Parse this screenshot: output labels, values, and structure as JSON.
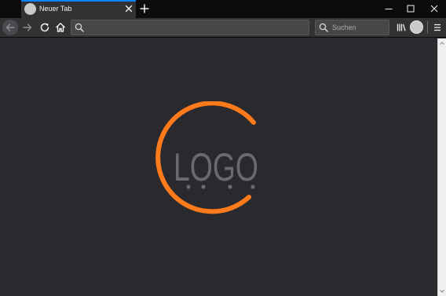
{
  "tab": {
    "title": "Neuer Tab"
  },
  "searchbar": {
    "placeholder": "Suchen"
  },
  "page": {
    "logo_text": "LOGO"
  },
  "colors": {
    "tab_accent": "#0a84ff",
    "logo_ring": "#ff7a1a",
    "logo_text": "#6a6a6e",
    "page_background": "#2a2a2e"
  },
  "icons": [
    "close-icon",
    "plus-icon",
    "minimize-icon",
    "maximize-icon",
    "window-close-icon",
    "back-arrow-icon",
    "forward-arrow-icon",
    "reload-icon",
    "home-icon",
    "search-icon",
    "library-icon",
    "account-icon",
    "hamburger-menu-icon"
  ]
}
